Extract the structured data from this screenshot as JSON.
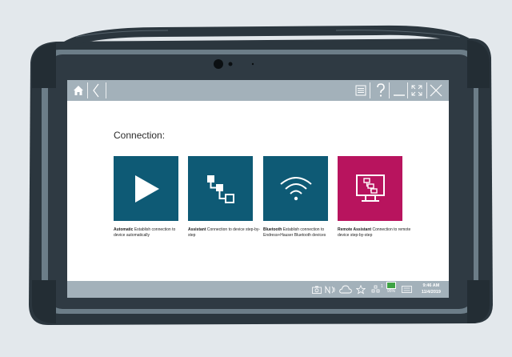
{
  "window": {
    "title": "",
    "nav": {
      "home_icon": "home-icon",
      "back_icon": "chevron-left-icon"
    },
    "controls": [
      "menu-icon",
      "help-icon",
      "minimize-icon",
      "expand-icon",
      "close-icon"
    ]
  },
  "page": {
    "title": "Connection:"
  },
  "connection_options": [
    {
      "id": "automatic",
      "name": "Automatic",
      "description": "Establish connection to device automatically",
      "icon": "play-icon",
      "color": "#0e5a75"
    },
    {
      "id": "assistant",
      "name": "Assistant",
      "description": "Connection to device step-by-step",
      "icon": "network-steps-icon",
      "color": "#0e5a75"
    },
    {
      "id": "bluetooth",
      "name": "Bluetooth",
      "description": "Establish connection to Endress+Hauser Bluetooth devices",
      "icon": "wifi-icon",
      "color": "#0e5a75"
    },
    {
      "id": "remote",
      "name": "Remote Assistant",
      "description": "Connection to remote device step-by-step",
      "icon": "remote-monitor-icon",
      "color": "#b8145e"
    }
  ],
  "taskbar": {
    "icons": [
      "camera-icon",
      "nfc-icon",
      "cloud-icon",
      "star-icon",
      "network-icon",
      "battery-icon",
      "keyboard-icon"
    ],
    "network_superscript": "1",
    "battery_label": "95%",
    "time": "9:46 AM",
    "date": "11/4/2019"
  },
  "colors": {
    "accent": "#0e5a75",
    "remote_accent": "#b8145e",
    "bar": "#a3b1ba",
    "bezel": "#2f3a43",
    "background": "#e3e8ec"
  }
}
